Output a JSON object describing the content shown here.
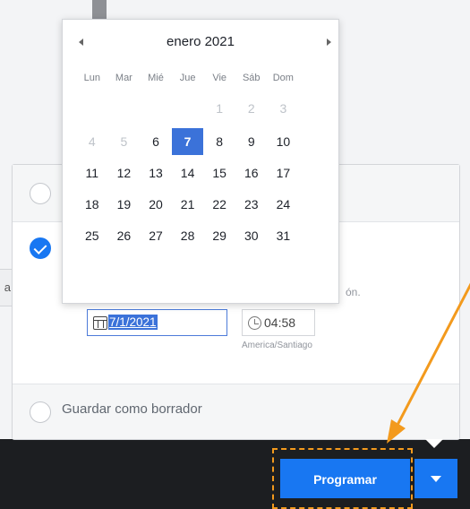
{
  "datepicker": {
    "month_title": "enero 2021",
    "weekdays": [
      "Lun",
      "Mar",
      "Mié",
      "Jue",
      "Vie",
      "Sáb",
      "Dom"
    ],
    "weeks": [
      [
        "",
        "",
        "",
        "",
        "1",
        "2",
        "3"
      ],
      [
        "4",
        "5",
        "6",
        "7",
        "8",
        "9",
        "10"
      ],
      [
        "11",
        "12",
        "13",
        "14",
        "15",
        "16",
        "17"
      ],
      [
        "18",
        "19",
        "20",
        "21",
        "22",
        "23",
        "24"
      ],
      [
        "25",
        "26",
        "27",
        "28",
        "29",
        "30",
        "31"
      ]
    ],
    "selected_day": "7"
  },
  "schedule": {
    "date_value": "7/1/2021",
    "time_value": "04:58",
    "timezone": "America/Santiago",
    "truncated_text": "ón."
  },
  "options": {
    "draft_label": "Guardar como borrador"
  },
  "background": {
    "input_fragment": "a"
  },
  "actions": {
    "schedule_button": "Programar"
  },
  "colors": {
    "primary": "#1877f2",
    "selected_day": "#3b72d9",
    "annotation": "#f39a1d"
  }
}
